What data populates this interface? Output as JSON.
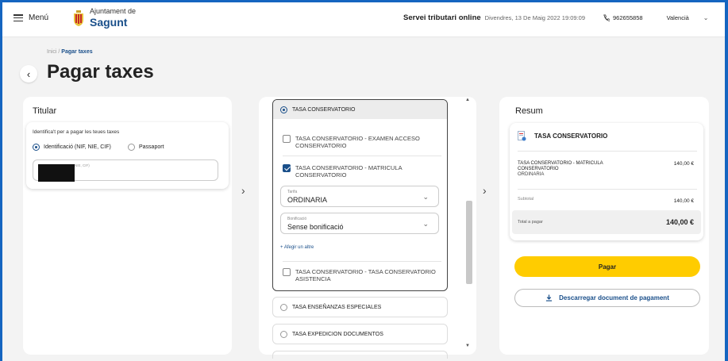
{
  "header": {
    "menu_label": "Menú",
    "org_line1": "Ajuntament de",
    "org_line2": "Sagunt",
    "service": "Servei tributari online",
    "datetime": "Divendres, 13 De Maig 2022 19:09:09",
    "phone": "962655858",
    "language": "Valencià"
  },
  "breadcrumb": {
    "home": "Inici",
    "sep": " / ",
    "current": "Pagar taxes"
  },
  "page_title": "Pagar taxes",
  "titular": {
    "heading": "Titular",
    "prompt": "Identifica't per a pagar les teues taxes",
    "options": [
      "Identificació (NIF, NIE, CIF)",
      "Passaport"
    ],
    "input_hint": "NIE, CIF)"
  },
  "taxes": {
    "selected_group": "TASA CONSERVATORIO",
    "items": [
      {
        "label": "TASA CONSERVATORIO - EXAMEN ACCESO CONSERVATORIO",
        "checked": false
      },
      {
        "label": "TASA CONSERVATORIO - MATRICULA CONSERVATORIO",
        "checked": true
      },
      {
        "label": "TASA CONSERVATORIO - TASA CONSERVATORIO ASISTENCIA",
        "checked": false
      }
    ],
    "tarifa": {
      "label": "Tarifa",
      "value": "ORDINARIA"
    },
    "bonificacio": {
      "label": "Bonificació",
      "value": "Sense bonificació"
    },
    "add_other": "+ Afegir un altre",
    "other_groups": [
      "TASA ENSEÑANZAS ESPECIALES",
      "TASA EXPEDICION DOCUMENTOS"
    ]
  },
  "resum": {
    "heading": "Resum",
    "group": "TASA CONSERVATORIO",
    "item_name": "TASA CONSERVATORIO - MATRICULA CONSERVATORIO",
    "item_sub": "ORDINARIA",
    "item_amount": "140,00 €",
    "subtotal_label": "Subtotal",
    "subtotal": "140,00 €",
    "total_label": "Total a pagar",
    "total": "140,00 €",
    "pay_button": "Pagar",
    "download_button": "Descarregar document de pagament"
  },
  "colors": {
    "accent": "#1a4f8a",
    "pay": "#ffcc00",
    "frame": "#1565c0"
  }
}
